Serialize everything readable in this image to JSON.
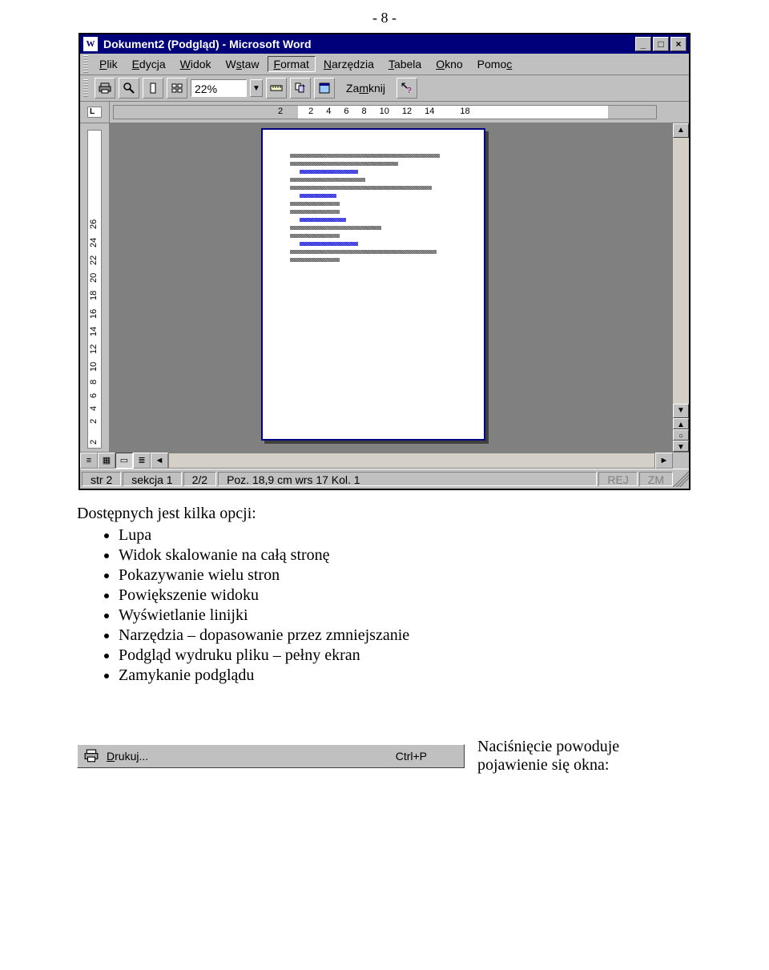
{
  "page_header": "- 8 -",
  "window": {
    "title": "Dokument2 (Podgląd) - Microsoft Word",
    "doc_icon_letter": "W",
    "btn_min": "_",
    "btn_max": "□",
    "btn_close": "×"
  },
  "menu": {
    "plik": "Plik",
    "edycja": "Edycja",
    "widok": "Widok",
    "wstaw": "Wstaw",
    "format": "Format",
    "narzedzia": "Narzędzia",
    "tabela": "Tabela",
    "okno": "Okno",
    "pomoc": "Pomoc"
  },
  "toolbar": {
    "zoom_value": "22%",
    "close_label": "Zamknij"
  },
  "hruler_ticks": [
    "2",
    "",
    "2",
    "4",
    "6",
    "8",
    "10",
    "12",
    "14",
    "",
    "18"
  ],
  "vruler_ticks": [
    "2",
    "",
    "2",
    "4",
    "6",
    "8",
    "10",
    "12",
    "14",
    "16",
    "18",
    "20",
    "22",
    "24",
    "26"
  ],
  "status": {
    "page": "str 2",
    "section": "sekcja 1",
    "pages": "2/2",
    "pos": "Poz. 18,9 cm  wrs 17   Kol. 1",
    "rec": "REJ",
    "zm": "ZM"
  },
  "body": {
    "lead": "Dostępnych jest kilka opcji:",
    "items": [
      "Lupa",
      "Widok skalowanie na całą stronę",
      "Pokazywanie wielu stron",
      "Powiększenie widoku",
      "Wyświetlanie linijki",
      "Narzędzia – dopasowanie przez zmniejszanie",
      "Podgląd wydruku pliku – pełny ekran",
      "Zamykanie podglądu"
    ]
  },
  "print": {
    "label": "Drukuj...",
    "shortcut": "Ctrl+P",
    "caption": "Naciśnięcie powoduje pojawienie się okna:"
  }
}
